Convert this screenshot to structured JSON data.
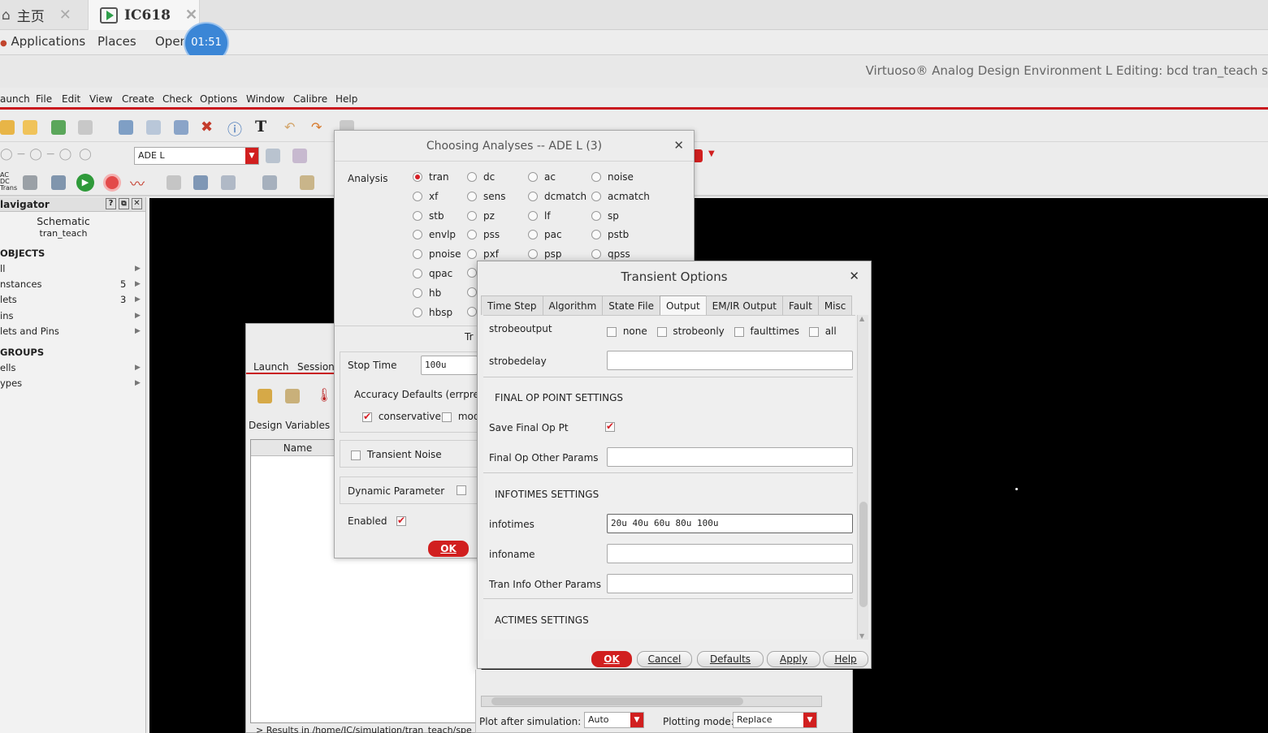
{
  "browser_tabs": {
    "home": "主页",
    "ic": "IC618"
  },
  "gnome_bar": {
    "applications": "Applications",
    "places": "Places",
    "open": "Open",
    "timer": "01:51"
  },
  "window_title": "Virtuoso® Analog Design Environment L Editing: bcd tran_teach s",
  "menu": [
    "aunch",
    "File",
    "Edit",
    "View",
    "Create",
    "Check",
    "Options",
    "Window",
    "Calibre",
    "Help"
  ],
  "toolbar": {
    "view_combo": "ADE L"
  },
  "navigator": {
    "title": "lavigator",
    "view": "Schematic",
    "cell": "tran_teach",
    "objects_heading": "OBJECTS",
    "rows": [
      {
        "label": "ll",
        "count": ""
      },
      {
        "label": "nstances",
        "count": "5"
      },
      {
        "label": "lets",
        "count": "3"
      },
      {
        "label": "ins",
        "count": ""
      },
      {
        "label": "lets and Pins",
        "count": ""
      }
    ],
    "groups_heading": "GROUPS",
    "group_rows": [
      {
        "label": "ells"
      },
      {
        "label": "ypes"
      }
    ]
  },
  "ade_window": {
    "menu_launch": "Launch",
    "menu_session": "Session",
    "design_variables": "Design Variables",
    "col_name": "Name",
    "results": "> Results in /home/IC/simulation/tran_teach/spe"
  },
  "choosing": {
    "title": "Choosing Analyses -- ADE L (3)",
    "analysis_label": "Analysis",
    "analyses": [
      [
        "tran",
        "dc",
        "ac",
        "noise"
      ],
      [
        "xf",
        "sens",
        "dcmatch",
        "acmatch"
      ],
      [
        "stb",
        "pz",
        "lf",
        "sp"
      ],
      [
        "envlp",
        "pss",
        "pac",
        "pstb"
      ],
      [
        "pnoise",
        "pxf",
        "psp",
        "qpss"
      ],
      [
        "qpac",
        "",
        "",
        ""
      ],
      [
        "hb",
        "",
        "",
        ""
      ],
      [
        "hbsp",
        "",
        "",
        ""
      ]
    ],
    "selected": "tran",
    "partial_heading": "Tr",
    "stop_time_label": "Stop Time",
    "stop_time_value": "100u",
    "accuracy_label": "Accuracy Defaults (errprese",
    "conservative": "conservative",
    "moderate_partial": "mod",
    "transient_noise": "Transient Noise",
    "dynamic_parameter": "Dynamic Parameter",
    "enabled": "Enabled",
    "ok": "OK"
  },
  "transient": {
    "title": "Transient Options",
    "tabs": [
      "Time Step",
      "Algorithm",
      "State File",
      "Output",
      "EM/IR Output",
      "Fault",
      "Misc"
    ],
    "active_tab": "Output",
    "strobeoutput_label": "strobeoutput",
    "strobe_options": [
      "none",
      "strobeonly",
      "faulttimes",
      "all"
    ],
    "strobedelay_label": "strobedelay",
    "strobedelay_value": "",
    "final_op_heading": "FINAL OP POINT SETTINGS",
    "save_final_label": "Save Final Op Pt",
    "final_other_label": "Final Op Other Params",
    "final_other_value": "",
    "infotimes_heading": "INFOTIMES SETTINGS",
    "infotimes_label": "infotimes",
    "infotimes_value": "20u 40u 60u 80u 100u",
    "infoname_label": "infoname",
    "infoname_value": "",
    "tran_info_label": "Tran Info Other Params",
    "tran_info_value": "",
    "actimes_heading": "ACTIMES SETTINGS",
    "buttons": {
      "ok": "OK",
      "cancel": "Cancel",
      "defaults": "Defaults",
      "apply": "Apply",
      "help": "Help"
    }
  },
  "bottom_bar": {
    "plot_after_label": "Plot after simulation:",
    "plot_after_value": "Auto",
    "plotting_mode_label": "Plotting mode:",
    "plotting_mode_value": "Replace"
  },
  "colors": {
    "accent_red": "#d11f1f",
    "timer_blue": "#3b86d6",
    "canvas": "#000000"
  }
}
